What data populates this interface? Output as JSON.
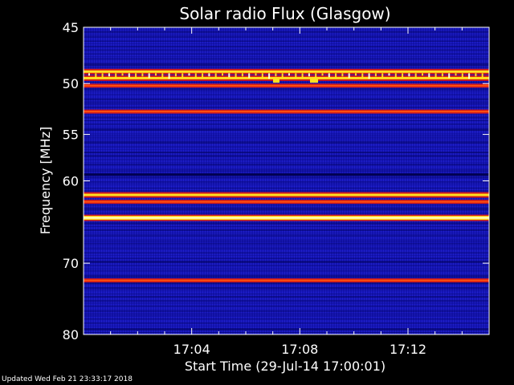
{
  "chart_data": {
    "type": "heatmap",
    "title": "Solar radio Flux (Glasgow)",
    "ylabel": "Frequency [MHz]",
    "xlabel": "Start Time (29-Jul-14 17:00:01)",
    "x_ticks": [
      "17:04",
      "17:08",
      "17:12"
    ],
    "x_tick_minutes": [
      4,
      8,
      12
    ],
    "xlim_minutes": [
      0,
      15
    ],
    "y_ticks": [
      45,
      50,
      55,
      60,
      70,
      80
    ],
    "ylim": [
      45,
      80
    ],
    "y_scale": "log",
    "colors": {
      "background": "#1414b4",
      "low": "#000050",
      "mid": "#d01818",
      "high": "#ffe020",
      "peak": "#ffffd0"
    },
    "emission_bands": [
      {
        "freq": 48.9,
        "level": "high"
      },
      {
        "freq": 49.5,
        "level": "high"
      },
      {
        "freq": 50.2,
        "level": "mid"
      },
      {
        "freq": 52.7,
        "level": "mid"
      },
      {
        "freq": 59.3,
        "level": "low"
      },
      {
        "freq": 61.6,
        "level": "high"
      },
      {
        "freq": 62.4,
        "level": "mid"
      },
      {
        "freq": 64.3,
        "level": "peak"
      },
      {
        "freq": 72.3,
        "level": "mid"
      }
    ]
  },
  "footer": "Updated Wed Feb 21 23:33:17 2018"
}
